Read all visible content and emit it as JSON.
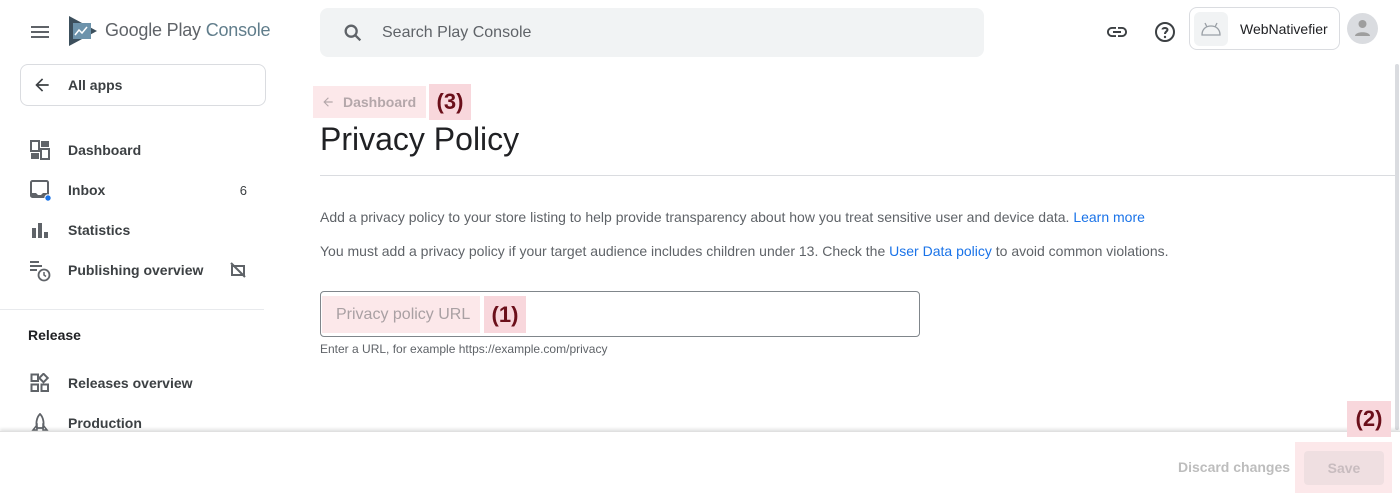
{
  "brand": {
    "name": "Google Play",
    "product": "Console"
  },
  "sidebar": {
    "all_apps_label": "All apps",
    "items": [
      {
        "label": "Dashboard",
        "icon": "dashboard-icon"
      },
      {
        "label": "Inbox",
        "icon": "inbox-icon",
        "badge": "6"
      },
      {
        "label": "Statistics",
        "icon": "bar-chart-icon"
      },
      {
        "label": "Publishing overview",
        "icon": "publishing-overview-icon",
        "trailing_icon": "sync-disabled-icon"
      }
    ],
    "sections": [
      {
        "title": "Release",
        "items": [
          {
            "label": "Releases overview",
            "icon": "releases-overview-icon"
          },
          {
            "label": "Production",
            "icon": "rocket-icon"
          }
        ]
      }
    ]
  },
  "header": {
    "search_placeholder": "Search Play Console",
    "developer_name": "WebNativefier"
  },
  "main": {
    "breadcrumb": "Dashboard",
    "title": "Privacy Policy",
    "para1": "Add a privacy policy to your store listing to help provide transparency about how you treat sensitive user and device data.",
    "para1_link": "Learn more",
    "para2_before": "You must add a privacy policy if your target audience includes children under 13. Check the",
    "para2_link": "User Data policy",
    "para2_after": "to avoid common violations.",
    "url_field": {
      "placeholder": "Privacy policy URL",
      "value": ""
    },
    "helper_text": "Enter a URL, for example https://example.com/privacy"
  },
  "footer": {
    "discard_label": "Discard changes",
    "save_label": "Save"
  },
  "annotations": {
    "field": "(1)",
    "save": "(2)",
    "breadcrumb": "(3)"
  },
  "colors": {
    "link": "#1a73e8",
    "annotation_bg": "#f8d7dc",
    "annotation_text": "#6b0f1a",
    "inbox_dot": "#1a73e8"
  }
}
